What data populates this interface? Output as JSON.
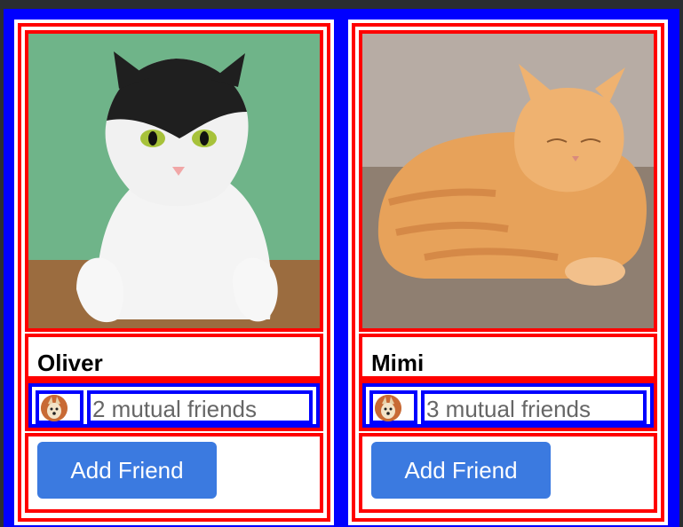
{
  "cards": [
    {
      "name": "Oliver",
      "mutual_text": "2 mutual friends",
      "button_label": "Add Friend"
    },
    {
      "name": "Mimi",
      "mutual_text": "3 mutual friends",
      "button_label": "Add Friend"
    }
  ],
  "colors": {
    "outer_border": "#0000ff",
    "card_border": "#ff0000",
    "button": "#3b7ae0"
  }
}
